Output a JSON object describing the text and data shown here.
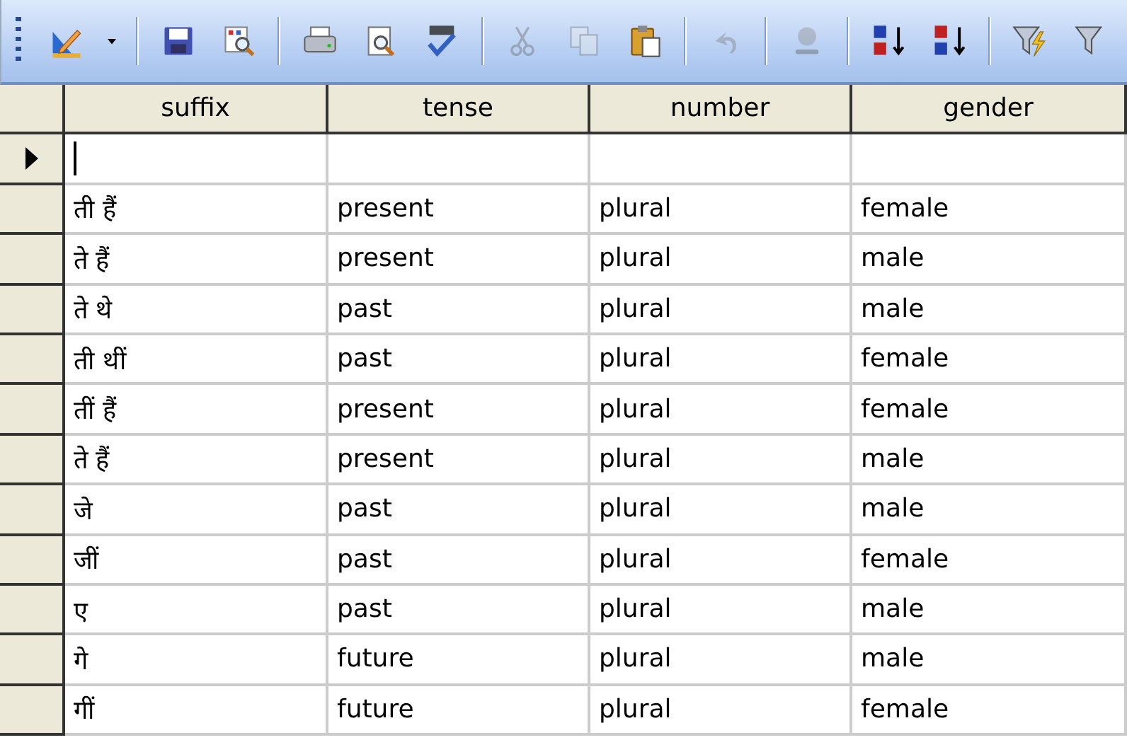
{
  "toolbar": [
    [
      {
        "disabled": false
      },
      {
        "disabled": false
      }
    ],
    [
      {
        "disabled": false
      },
      {
        "disabled": false
      }
    ],
    [
      {
        "disabled": false
      },
      {
        "disabled": false
      },
      {
        "disabled": false
      }
    ],
    [
      {
        "disabled": true
      },
      {
        "disabled": true
      },
      {
        "disabled": false
      }
    ],
    [
      {
        "disabled": true
      }
    ],
    [
      {
        "disabled": true
      }
    ],
    [
      {
        "disabled": false
      },
      {
        "disabled": false
      }
    ],
    [
      {
        "disabled": false
      },
      {
        "disabled": false
      }
    ]
  ],
  "table": {
    "columns": [
      "suffix",
      "tense",
      "number",
      "gender"
    ],
    "new_row": {
      "current": true,
      "editing": true
    },
    "rows": [
      {
        "current": false,
        "suffix": "ती हैं",
        "tense": "present",
        "number": "plural",
        "gender": "female"
      },
      {
        "current": false,
        "suffix": "ते हैं",
        "tense": "present",
        "number": "plural",
        "gender": "male"
      },
      {
        "current": false,
        "suffix": "ते थे",
        "tense": "past",
        "number": "plural",
        "gender": "male"
      },
      {
        "current": false,
        "suffix": "ती थीं",
        "tense": "past",
        "number": "plural",
        "gender": "female"
      },
      {
        "current": false,
        "suffix": "तीं हैं",
        "tense": "present",
        "number": "plural",
        "gender": "female"
      },
      {
        "current": false,
        "suffix": "ते हैं",
        "tense": "present",
        "number": "plural",
        "gender": "male"
      },
      {
        "current": false,
        "suffix": "जे",
        "tense": "past",
        "number": "plural",
        "gender": "male"
      },
      {
        "current": false,
        "suffix": "जीं",
        "tense": "past",
        "number": "plural",
        "gender": "female"
      },
      {
        "current": false,
        "suffix": "ए",
        "tense": "past",
        "number": "plural",
        "gender": "male"
      },
      {
        "current": false,
        "suffix": "गे",
        "tense": "future",
        "number": "plural",
        "gender": "male"
      },
      {
        "current": false,
        "suffix": "गीं",
        "tense": "future",
        "number": "plural",
        "gender": "female"
      }
    ]
  }
}
